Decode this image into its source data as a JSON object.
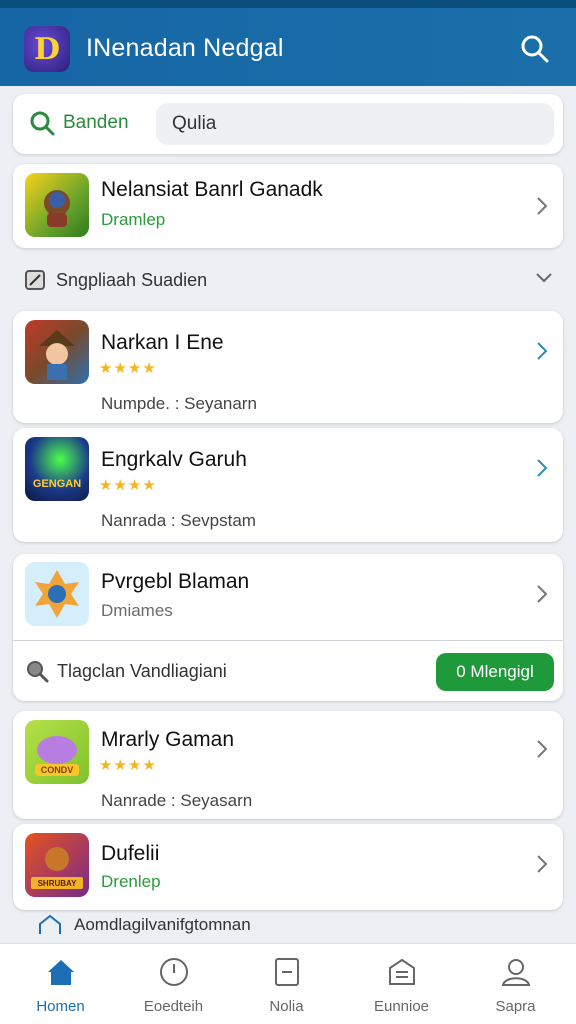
{
  "app": {
    "title": "INenadan Nedgal",
    "logo_letter": "D"
  },
  "search": {
    "label": "Banden",
    "value": "Qulia"
  },
  "featured": {
    "title": "Nelansiat Banrl Ganadk",
    "subtitle": "Dramlep"
  },
  "section": {
    "label": "Sngpliaah Suadien"
  },
  "games": [
    {
      "title": "Narkan I Ene",
      "stars": "★★★★",
      "meta": "Numpde. : Seyanarn"
    },
    {
      "title": "Engrkalv Garuh",
      "stars": "★★★★",
      "meta": "Nanrada : Sevpstam",
      "icon_text": "GENGAN"
    },
    {
      "title": "Pvrgebl Blaman",
      "subtitle": "Dmiames"
    }
  ],
  "promo": {
    "label": "Tlagclan Vandliagiani",
    "button": "0 Mlengigl"
  },
  "games2": [
    {
      "title": "Mrarly Gaman",
      "stars": "★★★★",
      "meta": "Nanrade : Seyasarn",
      "icon_text": "CONDV"
    },
    {
      "title": "Dufelii",
      "subtitle": "Drenlep",
      "icon_text": "SHRUBAY"
    }
  ],
  "footer": {
    "hint": "Aomdlagilvanifgtomnan"
  },
  "nav": [
    {
      "label": "Homen",
      "icon": "home-icon",
      "active": true
    },
    {
      "label": "Eoedteih",
      "icon": "clock-icon"
    },
    {
      "label": "Nolia",
      "icon": "document-icon"
    },
    {
      "label": "Eunnioe",
      "icon": "inbox-icon"
    },
    {
      "label": "Sapra",
      "icon": "profile-icon"
    }
  ],
  "colors": {
    "appbar": "#1a6fa9",
    "accent_green": "#2a9a3c",
    "nav_active": "#1c6fb5"
  }
}
